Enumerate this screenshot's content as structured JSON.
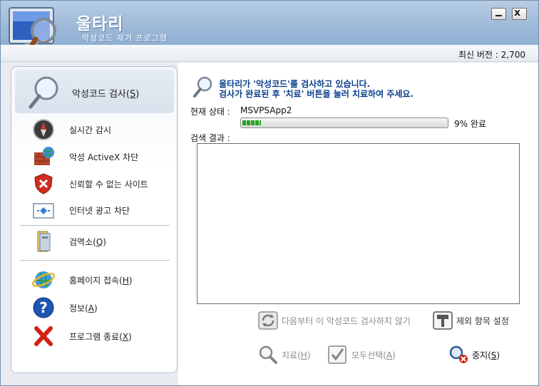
{
  "app": {
    "title": "울타리",
    "subtitle": "악성코드 제거 프로그램",
    "version_text": "최신 버전 : 2,700"
  },
  "window_controls": {
    "minimize_icon": "minimize-icon",
    "close_glyph": "x"
  },
  "sidebar": {
    "scan": {
      "label": "악성코드 검사",
      "key": "S",
      "icon": "magnifier-icon"
    },
    "items": [
      {
        "label": "실시간 감시",
        "key": "",
        "icon": "compass-icon"
      },
      {
        "label": "악성 ActiveX 차단",
        "key": "",
        "icon": "firewall-globe-icon"
      },
      {
        "label": "신뢰할 수 없는 사이트",
        "key": "",
        "icon": "shield-x-icon"
      },
      {
        "label": "인터넷 광고 차단",
        "key": "",
        "icon": "ad-block-icon"
      },
      {
        "label": "검역소",
        "key": "Q",
        "icon": "quarantine-icon"
      },
      {
        "label": "홈페이지 접속",
        "key": "H",
        "icon": "ie-globe-icon"
      },
      {
        "label": "정보",
        "key": "A",
        "icon": "help-icon"
      },
      {
        "label": "프로그램 종료",
        "key": "X",
        "icon": "close-x-icon"
      }
    ]
  },
  "main": {
    "message_line1": "울타리가 '악성코드'를 검사하고 있습니다.",
    "message_line2": "검사가 완료된 후 '치료' 버튼을 눌러 치료하여 주세요.",
    "current_status_label": "현재 상태 :",
    "current_status_value": "MSVPSApp2",
    "progress_percent": 9,
    "progress_text": "9% 완료",
    "result_label": "검색 결과 :",
    "results": []
  },
  "actions": {
    "skip": {
      "label": "다음부터 이 악성코드 검사하지 않기",
      "key": "",
      "icon": "skip-icon"
    },
    "exclude": {
      "label": "제외 항목 설정",
      "key": "",
      "icon": "hammer-icon"
    },
    "cure": {
      "label": "치료",
      "key": "H",
      "icon": "cure-magnifier-icon"
    },
    "select_all": {
      "label": "모두선택",
      "key": "A",
      "icon": "checkbox-icon"
    },
    "stop": {
      "label": "중지",
      "key": "S",
      "icon": "stop-icon"
    }
  },
  "colors": {
    "header_blue": "#9fbad8",
    "message_blue": "#0a3f8c",
    "progress_green": "#26a41f"
  }
}
